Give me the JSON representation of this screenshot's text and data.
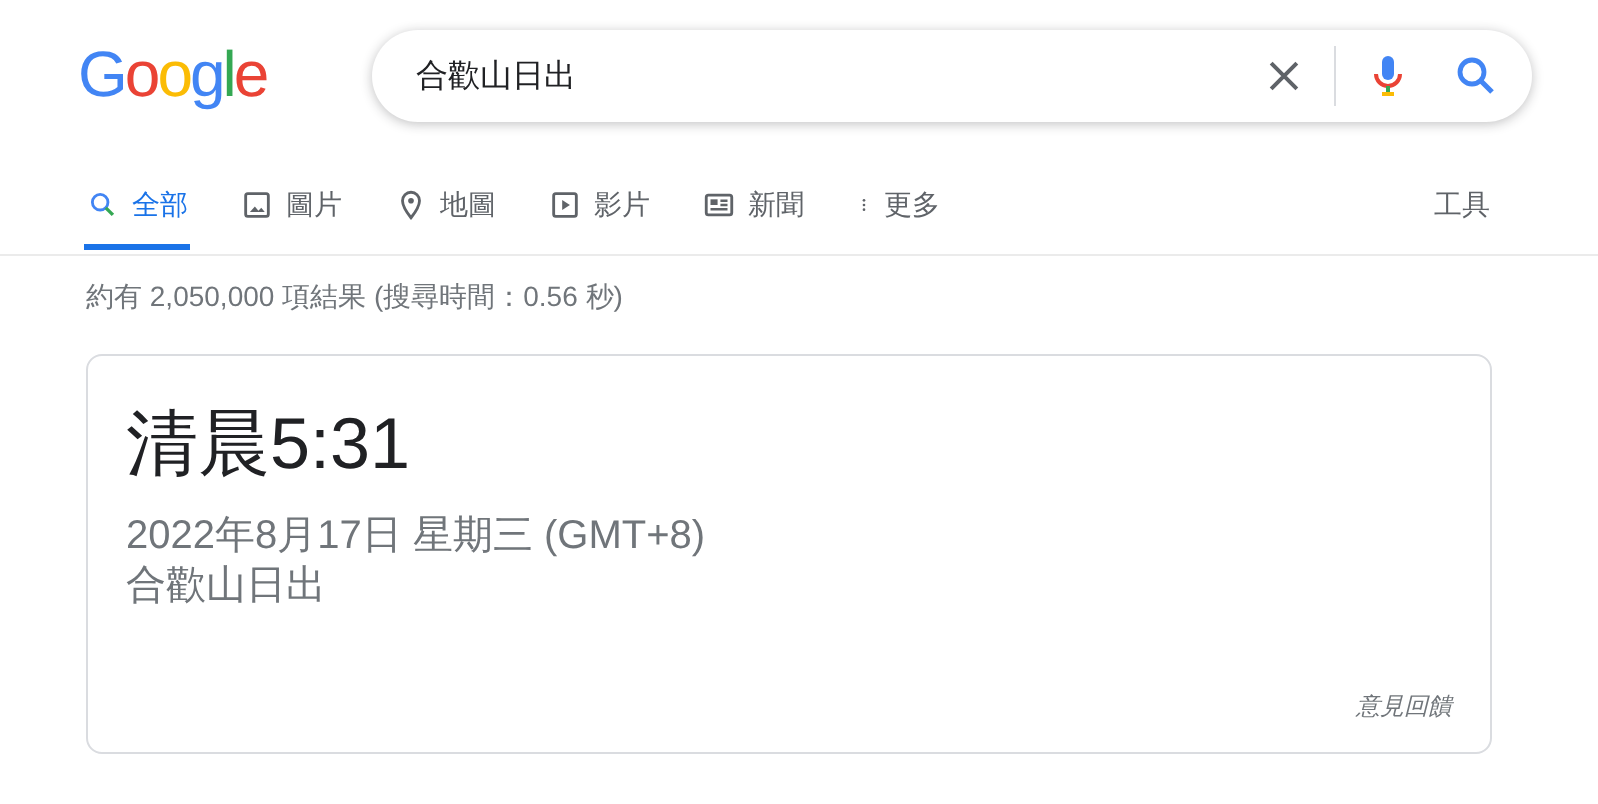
{
  "logo": "Google",
  "search": {
    "value": "合歡山日出"
  },
  "tabs": [
    {
      "kind": "all",
      "label": "全部",
      "selected": true
    },
    {
      "kind": "images",
      "label": "圖片",
      "selected": false
    },
    {
      "kind": "maps",
      "label": "地圖",
      "selected": false
    },
    {
      "kind": "videos",
      "label": "影片",
      "selected": false
    },
    {
      "kind": "news",
      "label": "新聞",
      "selected": false
    },
    {
      "kind": "more",
      "label": "更多",
      "selected": false
    }
  ],
  "tools": "工具",
  "result_stats": "約有 2,050,000 項結果 (搜尋時間：0.56 秒)",
  "answer_card": {
    "time": "清晨5:31",
    "date": "2022年8月17日 星期三 (GMT+8)",
    "subject": "合歡山日出",
    "feedback": "意見回饋"
  }
}
